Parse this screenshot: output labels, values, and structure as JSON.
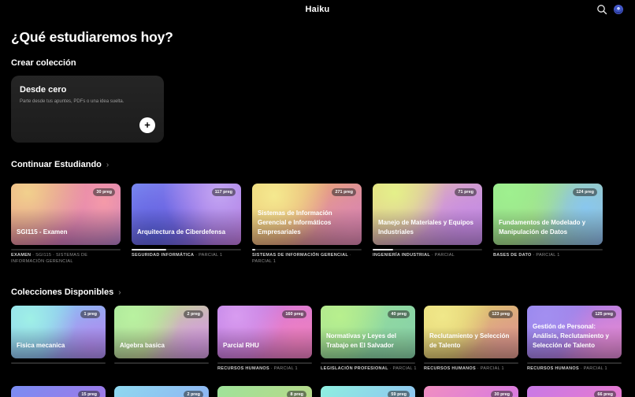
{
  "app": {
    "title": "Haiku"
  },
  "hero": "¿Qué estudiaremos hoy?",
  "create": {
    "section_title": "Crear colección",
    "card_title": "Desde cero",
    "card_subtitle": "Parte desde tus apuntes, PDFs o una idea suelta.",
    "plus": "+"
  },
  "continue_section": {
    "title": "Continuar Estudiando",
    "chevron": "›",
    "cards": [
      {
        "title": "SGI115 - Examen",
        "badge": "30 preg",
        "meta_type": "EXAMEN",
        "meta_rest": " · SGI115 · SISTEMAS DE INFORMACIÓN GERENCIAL",
        "progress": 0
      },
      {
        "title": "Arquitectura de Ciberdefensa",
        "badge": "117 preg",
        "meta_type": "SEGURIDAD INFORMÁTICA",
        "meta_rest": " · PARCIAL 1",
        "progress": 0.32
      },
      {
        "title": "Sistemas de Información Gerencial e Informáticos Empresariales",
        "badge": "271 preg",
        "meta_type": "SISTEMAS DE INFORMACIÓN GERENCIAL",
        "meta_rest": " · PARCIAL 1",
        "progress": 0.03
      },
      {
        "title": "Manejo de Materiales y Equipos Industriales",
        "badge": "71 preg",
        "meta_type": "INGENIERÍA INDUSTRIAL",
        "meta_rest": " · PARCIAL",
        "progress": 0.19
      },
      {
        "title": "Fundamentos de Modelado y Manipulación de Datos",
        "badge": "124 preg",
        "meta_type": "BASES DE DATO",
        "meta_rest": " · PARCIAL 1",
        "progress": 0
      }
    ]
  },
  "available_section": {
    "title": "Colecciones Disponibles",
    "chevron": "›",
    "cards": [
      {
        "title": "Fisica mecanica",
        "badge": "1 preg",
        "meta_type": "",
        "meta_rest": ""
      },
      {
        "title": "Algebra basica",
        "badge": "2 preg",
        "meta_type": "",
        "meta_rest": ""
      },
      {
        "title": "Parcial RHU",
        "badge": "160 preg",
        "meta_type": "RECURSOS HUMANOS",
        "meta_rest": " · PARCIAL 1"
      },
      {
        "title": "Normativas y Leyes del Trabajo en El Salvador",
        "badge": "40 preg",
        "meta_type": "LEGISLACIÓN PROFESIONAL",
        "meta_rest": " · PARCIAL 1"
      },
      {
        "title": "Reclutamiento y Selección de Talento",
        "badge": "123 preg",
        "meta_type": "RECURSOS HUMANOS",
        "meta_rest": " · PARCIAL 1"
      },
      {
        "title": "Gestión de Personal: Análisis, Reclutamiento y Selección de Talento",
        "badge": "125 preg",
        "meta_type": "RECURSOS HUMANOS",
        "meta_rest": " · PARCIAL 1"
      }
    ],
    "next_row_badges": [
      "15 preg",
      "2 preg",
      "8 preg",
      "59 preg",
      "30 preg",
      "66 preg"
    ]
  }
}
